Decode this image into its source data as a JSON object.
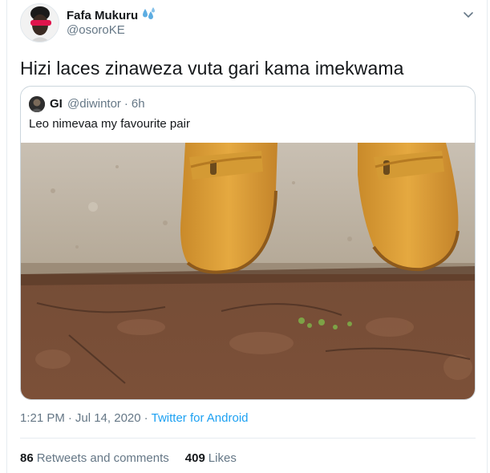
{
  "author": {
    "name": "Fafa Mukuru",
    "handle": "@osoroKE",
    "badge_icon": "water-drops-icon"
  },
  "tweet": {
    "text": "Hizi laces zinaweza vuta gari kama imekwama"
  },
  "quoted_tweet": {
    "name": "GI",
    "handle": "@diwintor",
    "separator": "·",
    "time": "6h",
    "text": "Leo nimevaa my favourite pair",
    "image_alt": "Pair of tan boots standing on a concrete step above muddy ground"
  },
  "meta": {
    "time": "1:21 PM",
    "date": "Jul 14, 2020",
    "separator": "·",
    "client": "Twitter for Android"
  },
  "stats": {
    "retweets_count": "86",
    "retweets_label": "Retweets and comments",
    "likes_count": "409",
    "likes_label": "Likes"
  },
  "colors": {
    "accent": "#1da1f2",
    "secondary_text": "#657786",
    "border": "#ccd6dd",
    "boot": "#e2a33a"
  }
}
